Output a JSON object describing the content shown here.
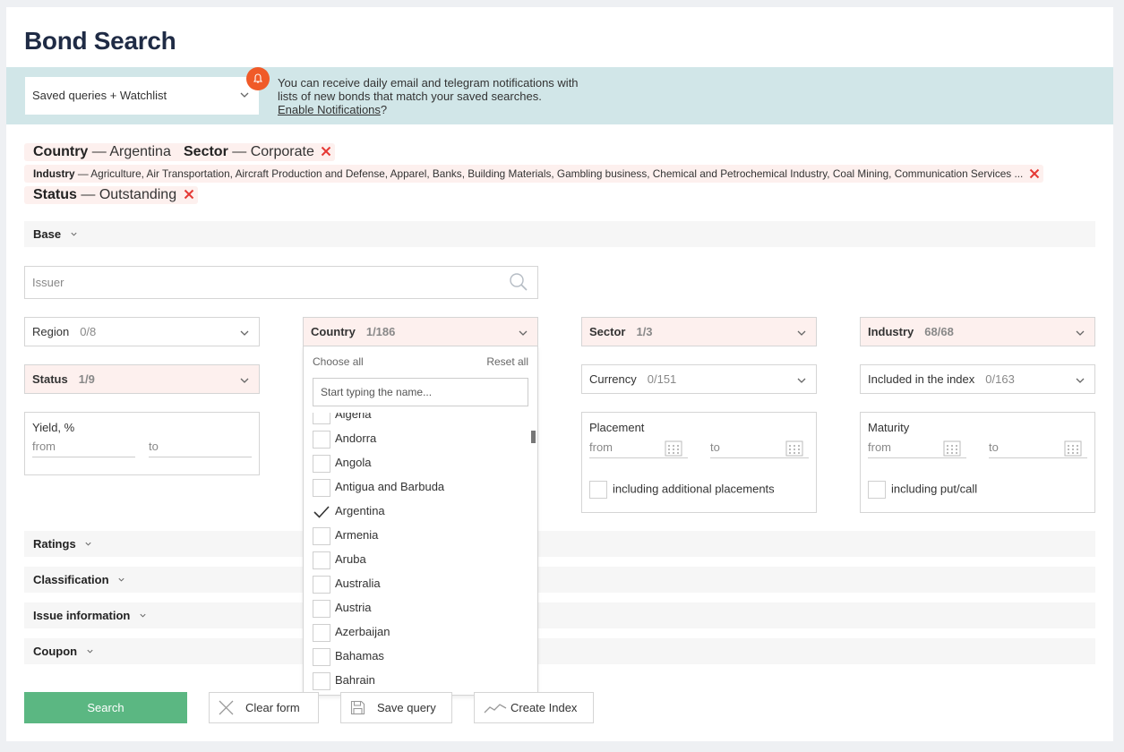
{
  "page": {
    "title": "Bond Search"
  },
  "notifications": {
    "saved_select": "Saved queries + Watchlist",
    "line1": "You can receive daily email and telegram notifications with",
    "line2": "lists of new bonds that match your saved searches.",
    "link": "Enable Notifications",
    "suffix": "?"
  },
  "filters": [
    {
      "label": "Country",
      "value": "Argentina"
    },
    {
      "label": "Sector",
      "value": "Corporate"
    },
    {
      "label": "Industry",
      "value": "Agriculture, Air Transportation, Aircraft Production and Defense, Apparel, Banks, Building Materials, Gambling business, Chemical and Petrochemical Industry, Coal Mining, Communication Services ..."
    },
    {
      "label": "Status",
      "value": "Outstanding"
    }
  ],
  "filter_separator": "—",
  "sections": {
    "base": "Base",
    "ratings": "Ratings",
    "classification": "Classification",
    "issue_information": "Issue information",
    "coupon": "Coupon"
  },
  "issuer": {
    "placeholder": "Issuer"
  },
  "dropdowns": {
    "region": {
      "label": "Region",
      "count": "0/8"
    },
    "country": {
      "label": "Country",
      "count": "1/186"
    },
    "sector": {
      "label": "Sector",
      "count": "1/3"
    },
    "industry": {
      "label": "Industry",
      "count": "68/68"
    },
    "status": {
      "label": "Status",
      "count": "1/9"
    },
    "currency": {
      "label": "Currency",
      "count": "0/151"
    },
    "index": {
      "label": "Included in the index",
      "count": "0/163"
    }
  },
  "yield": {
    "title": "Yield, %",
    "from": "from",
    "to": "to"
  },
  "placement": {
    "title": "Placement",
    "from": "from",
    "to": "to",
    "checkbox": "including additional placements"
  },
  "maturity": {
    "title": "Maturity",
    "from": "from",
    "to": "to",
    "checkbox": "including put/call"
  },
  "country_panel": {
    "choose_all": "Choose all",
    "reset_all": "Reset all",
    "search_placeholder": "Start typing the name...",
    "partial_top": "Algeria",
    "items": [
      {
        "name": "Andorra",
        "checked": false
      },
      {
        "name": "Angola",
        "checked": false
      },
      {
        "name": "Antigua and Barbuda",
        "checked": false
      },
      {
        "name": "Argentina",
        "checked": true
      },
      {
        "name": "Armenia",
        "checked": false
      },
      {
        "name": "Aruba",
        "checked": false
      },
      {
        "name": "Australia",
        "checked": false
      },
      {
        "name": "Austria",
        "checked": false
      },
      {
        "name": "Azerbaijan",
        "checked": false
      },
      {
        "name": "Bahamas",
        "checked": false
      },
      {
        "name": "Bahrain",
        "checked": false
      }
    ]
  },
  "buttons": {
    "search": "Search",
    "clear": "Clear form",
    "save": "Save query",
    "create_index": "Create Index"
  },
  "colors": {
    "accent_green": "#5bb782",
    "notify_bg": "#d1e6e8",
    "bell_orange": "#f05a28",
    "active_bg": "#fdf0ee",
    "remove_red": "#e53935"
  }
}
